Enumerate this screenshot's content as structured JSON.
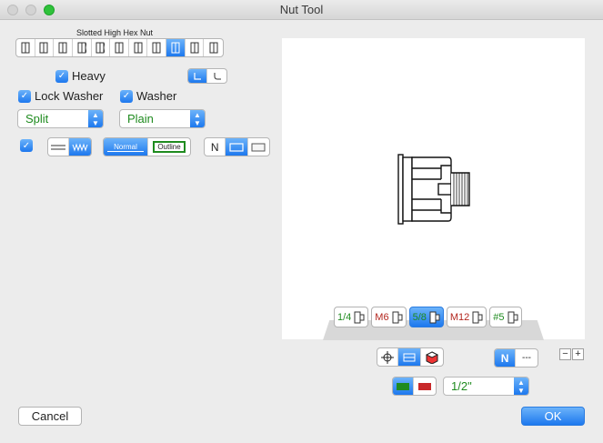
{
  "window": {
    "title": "Nut Tool"
  },
  "nut_type": {
    "label": "Slotted High Hex Nut",
    "options": [
      "nut-style-1",
      "nut-style-2",
      "nut-style-3",
      "nut-style-4",
      "nut-style-5",
      "nut-style-6",
      "nut-style-7",
      "nut-style-8",
      "nut-style-9",
      "nut-style-10",
      "nut-style-11"
    ],
    "selected_index": 8
  },
  "options": {
    "heavy": {
      "label": "Heavy",
      "checked": true
    },
    "lock_washer": {
      "label": "Lock Washer",
      "checked": true
    },
    "washer": {
      "label": "Washer",
      "checked": true
    },
    "lock_washer_type": "Split",
    "washer_type": "Plain",
    "thread_checkbox": {
      "checked": true
    }
  },
  "line_style": {
    "normal_label": "Normal",
    "outline_label": "Outline",
    "selected": "Normal"
  },
  "view_toggle": {
    "n_label": "N"
  },
  "sizes": [
    {
      "label": "1/4",
      "color": "#1f8b1f"
    },
    {
      "label": "M6",
      "color": "#b3261e"
    },
    {
      "label": "5/8",
      "color": "#1f8b1f",
      "selected": true
    },
    {
      "label": "M12",
      "color": "#b3261e"
    },
    {
      "label": "#5",
      "color": "#1f8b1f"
    }
  ],
  "bottom_controls": {
    "n_label": "N",
    "n_alt_label": "---",
    "minus_label": "−",
    "plus_label": "+",
    "size_value": "1/2\""
  },
  "colors": {
    "accent": "#1d78ee",
    "green": "#1f8b1f",
    "red": "#b3261e"
  },
  "buttons": {
    "cancel": "Cancel",
    "ok": "OK"
  }
}
